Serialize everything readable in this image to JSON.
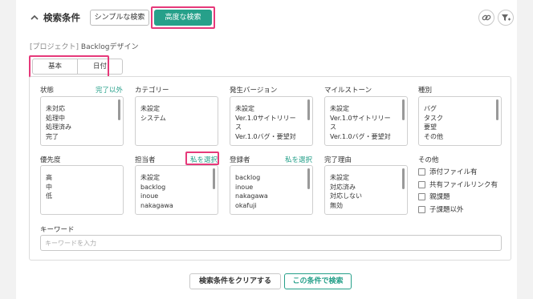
{
  "header": {
    "title": "検索条件",
    "simple_label": "シンプルな検索",
    "advanced_label": "高度な検索"
  },
  "project": {
    "prefix": "[プロジェクト]",
    "name": "Backlogデザイン"
  },
  "tabs": [
    {
      "label": "基本",
      "active": true
    },
    {
      "label": "日付",
      "active": false
    }
  ],
  "filters": {
    "status": {
      "label": "状態",
      "link": "完了以外",
      "options": [
        "未対応",
        "処理中",
        "処理済み",
        "完了"
      ]
    },
    "category": {
      "label": "カテゴリー",
      "options": [
        "未設定",
        "システム"
      ]
    },
    "version": {
      "label": "発生バージョン",
      "options": [
        "未設定",
        "Ver.1.0サイトリリー",
        "ス",
        "Ver.1.0バグ・要望対"
      ]
    },
    "milestone": {
      "label": "マイルストーン",
      "options": [
        "未設定",
        "Ver.1.0サイトリリー",
        "ス",
        "Ver.1.0バグ・要望対"
      ]
    },
    "type": {
      "label": "種別",
      "options": [
        "バグ",
        "タスク",
        "要望",
        "その他"
      ]
    },
    "priority": {
      "label": "優先度",
      "options": [
        "高",
        "中",
        "低"
      ]
    },
    "assignee": {
      "label": "担当者",
      "link": "私を選択",
      "options": [
        "未設定",
        "backlog",
        "inoue",
        "nakagawa"
      ]
    },
    "registrant": {
      "label": "登録者",
      "link": "私を選択",
      "options": [
        "backlog",
        "inoue",
        "nakagawa",
        "okafuji"
      ]
    },
    "resolution": {
      "label": "完了理由",
      "options": [
        "未設定",
        "対応済み",
        "対応しない",
        "無効"
      ]
    },
    "other": {
      "label": "その他",
      "checks": [
        {
          "label": "添付ファイル有",
          "checked": false
        },
        {
          "label": "共有ファイルリンク有",
          "checked": false
        },
        {
          "label": "親課題",
          "checked": false
        },
        {
          "label": "子課題以外",
          "checked": false
        }
      ]
    }
  },
  "keyword": {
    "label": "キーワード",
    "placeholder": "キーワードを入力",
    "value": ""
  },
  "actions": {
    "clear_label": "検索条件をクリアする",
    "search_label": "この条件で検索"
  },
  "colors": {
    "accent": "#26a08a",
    "highlight": "#e6397a"
  },
  "icons": [
    "chevron-up-icon",
    "link-icon",
    "filter-add-icon"
  ]
}
